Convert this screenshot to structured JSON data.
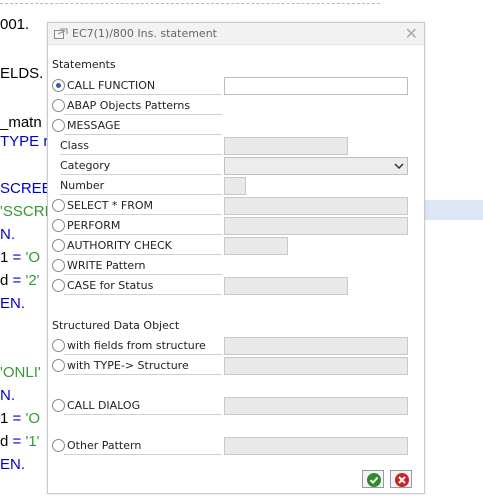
{
  "editor": {
    "lines": [
      {
        "text": "001.",
        "color": "#000000"
      },
      {
        "text": "ELDS.",
        "color": "#000000"
      },
      {
        "text": "_matn",
        "color": "#000000"
      },
      {
        "text": "TYPE r",
        "color": "#0000cc"
      },
      {
        "text": "SCREEI",
        "color": "#0000cc"
      },
      {
        "text": "'SSCRI",
        "color": "#339933"
      },
      {
        "text": "N.",
        "color": "#0000cc"
      },
      {
        "text": "1 = 'O",
        "color": "mixed"
      },
      {
        "text": "d = '2'",
        "color": "mixed"
      },
      {
        "text": "EN.",
        "color": "#0000cc"
      },
      {
        "text": "'ONLI'",
        "color": "#339933"
      },
      {
        "text": "N.",
        "color": "#0000cc"
      },
      {
        "text": "1 = 'O",
        "color": "mixed"
      },
      {
        "text": "d = '1'",
        "color": "mixed"
      },
      {
        "text": "EN.",
        "color": "#0000cc"
      }
    ]
  },
  "dialog": {
    "title": "EC7(1)/800 Ins. statement",
    "title_icon": "insert-statement-icon",
    "close_icon": "close-icon",
    "statements_label": "Statements",
    "options": {
      "call_function": "CALL FUNCTION",
      "abap_objects": "ABAP Objects Patterns",
      "message": "MESSAGE",
      "class": "Class",
      "category": "Category",
      "number": "Number",
      "select_from": "SELECT * FROM",
      "perform": "PERFORM",
      "authority_check": "AUTHORITY CHECK",
      "write_pattern": "WRITE Pattern",
      "case_for_status": "CASE for Status"
    },
    "structured_label": "Structured Data Object",
    "structured": {
      "with_fields": "with fields from structure",
      "with_type": "with TYPE-> Structure"
    },
    "call_dialog": "CALL DIALOG",
    "other_pattern": "Other Pattern",
    "selected": "call_function",
    "buttons": {
      "ok_icon": "checkmark-icon",
      "cancel_icon": "cancel-icon",
      "ok_color": "#2e8b2e",
      "cancel_color": "#cc2222"
    }
  }
}
